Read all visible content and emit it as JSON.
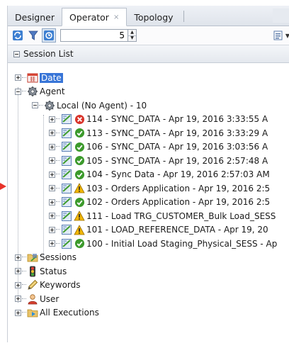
{
  "tabs": [
    {
      "label": "Designer",
      "active": false
    },
    {
      "label": "Operator",
      "active": true,
      "close": "×"
    },
    {
      "label": "Topology",
      "active": false
    }
  ],
  "toolbar": {
    "spinner_value": "5"
  },
  "section": {
    "title": "Session List"
  },
  "tree": {
    "date": "Date",
    "agent": "Agent",
    "local_agent": "Local (No Agent) - 10",
    "sessions_list": [
      {
        "status": "error",
        "text": "114 - SYNC_DATA - Apr 19, 2016 3:33:55 A"
      },
      {
        "status": "success",
        "text": "113 - SYNC_DATA - Apr 19, 2016 3:33:29 A"
      },
      {
        "status": "success",
        "text": "106 - SYNC_DATA - Apr 19, 2016 3:03:56 A"
      },
      {
        "status": "success",
        "text": "105 - SYNC_DATA - Apr 19, 2016 2:57:48 A"
      },
      {
        "status": "success",
        "text": "104 - Sync Data - Apr 19, 2016 2:57:03 AM"
      },
      {
        "status": "warning",
        "text": "103 - Orders Application - Apr 19, 2016 2:5"
      },
      {
        "status": "success",
        "text": "102 - Orders Application - Apr 19, 2016 2:5"
      },
      {
        "status": "warning",
        "text": "111 - Load TRG_CUSTOMER_Bulk Load_SESS"
      },
      {
        "status": "warning",
        "text": "101 - LOAD_REFERENCE_DATA - Apr 19, 20"
      },
      {
        "status": "success",
        "text": "100 - Initial Load Staging_Physical_SESS - Ap"
      }
    ],
    "sessions": "Sessions",
    "status": "Status",
    "keywords": "Keywords",
    "user": "User",
    "all_executions": "All Executions"
  },
  "colors": {
    "selection": "#3875d7",
    "error": "#d9342b",
    "success": "#3c9a2c",
    "warning": "#f2b705",
    "pointer": "#e8332a"
  }
}
